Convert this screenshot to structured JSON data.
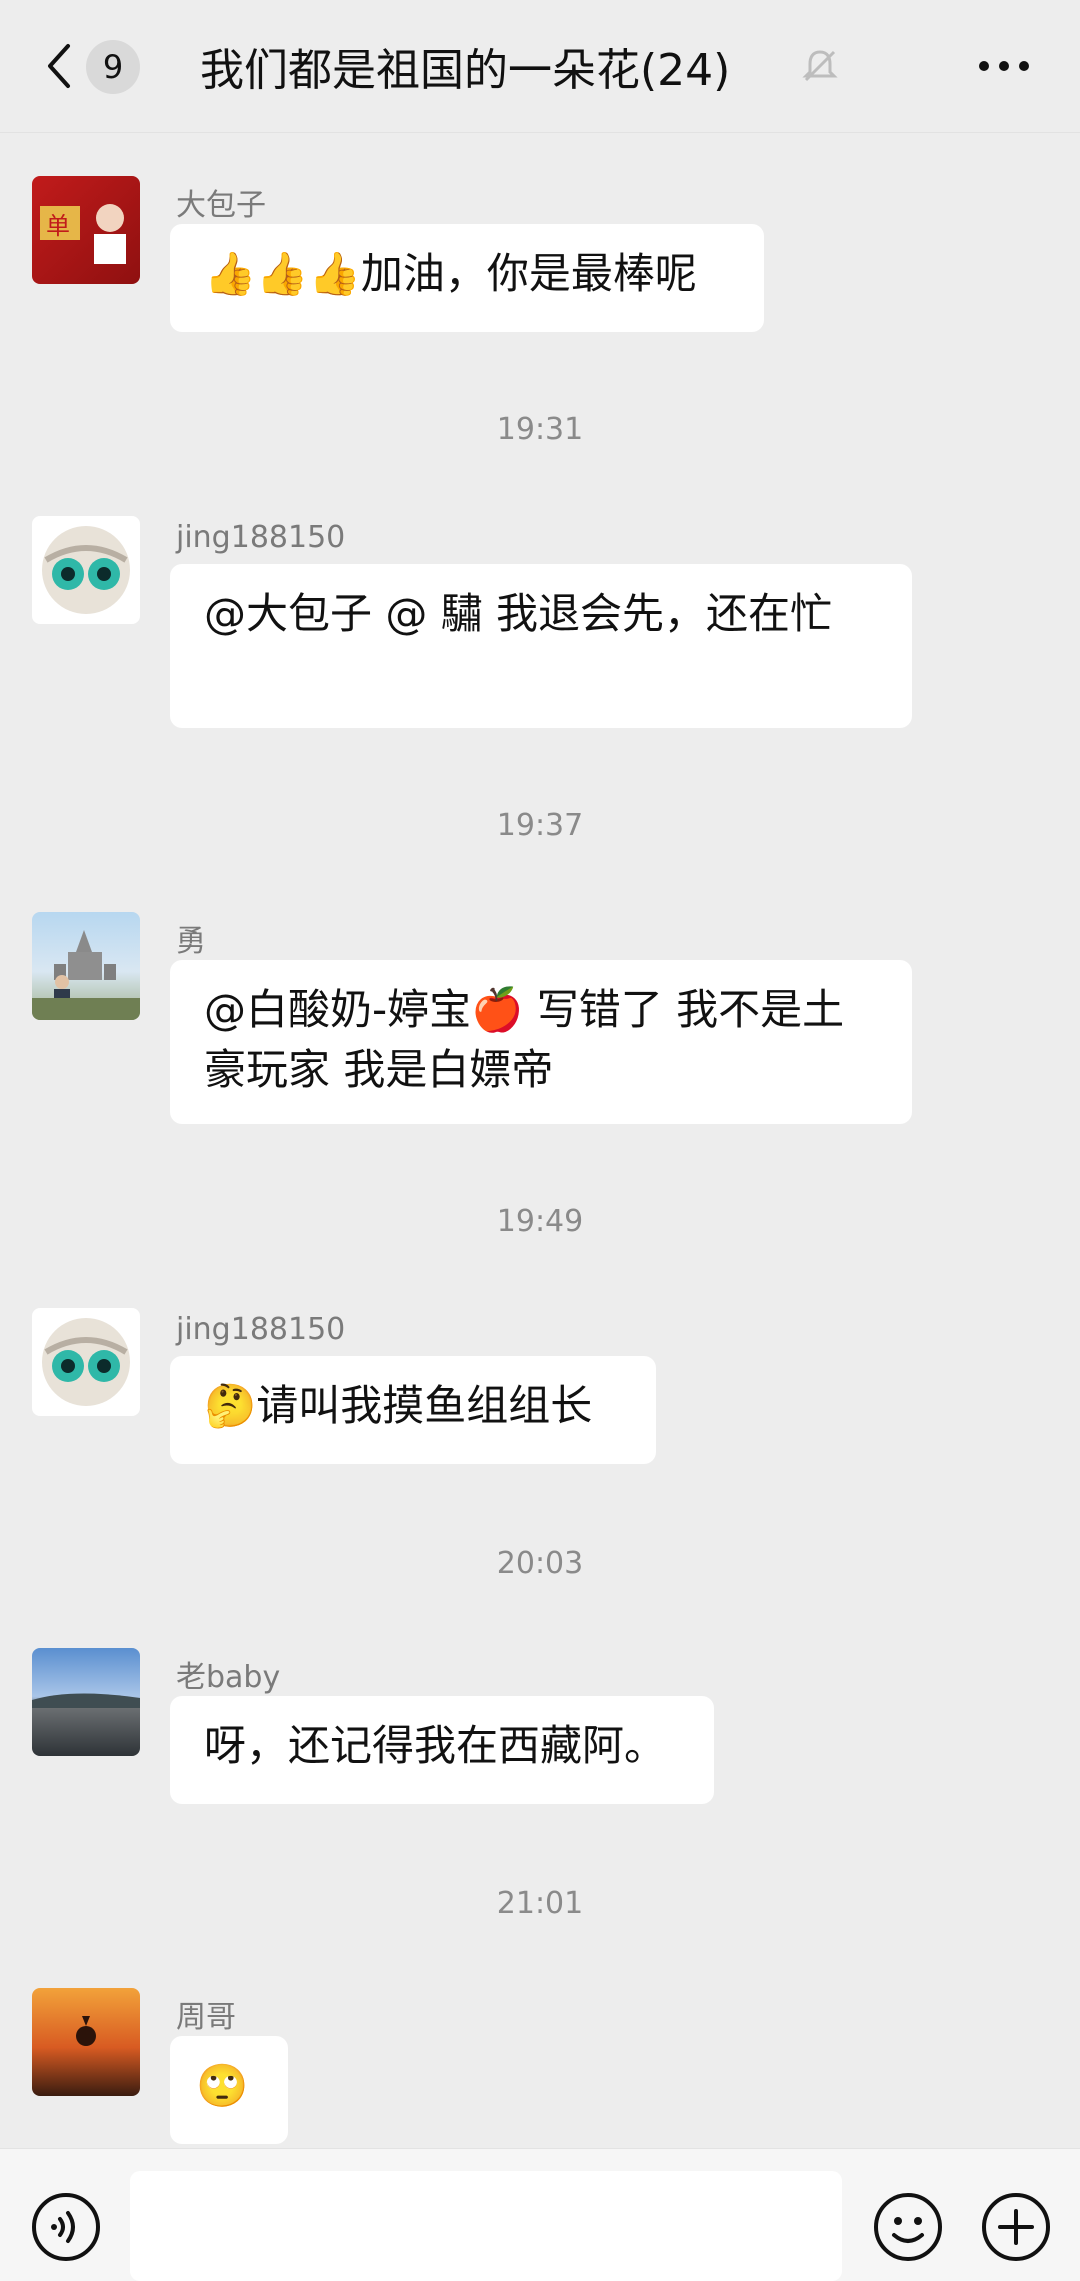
{
  "header": {
    "unread_count": "9",
    "title": "我们都是祖国的一朵花(24)"
  },
  "messages": [
    {
      "sender": "大包子",
      "text": "👍👍👍加油，你是最棒呢"
    },
    {
      "time": "19:31"
    },
    {
      "sender": "jing188150",
      "text": "@大包子 @    驌             我退会先，还在忙"
    },
    {
      "time": "19:37"
    },
    {
      "sender": "勇",
      "text": "@白酸奶-婷宝🍎  写错了  我不是土豪玩家  我是白嫖帝"
    },
    {
      "time": "19:49"
    },
    {
      "sender": "jing188150",
      "text": "🤔请叫我摸鱼组组长"
    },
    {
      "time": "20:03"
    },
    {
      "sender": "老baby",
      "text": "呀，还记得我在西藏阿。"
    },
    {
      "time": "21:01"
    },
    {
      "sender": "周哥",
      "text": "🙄"
    }
  ],
  "input": {
    "value": ""
  },
  "icons": {
    "back": "chevron-left-icon",
    "mute": "bell-off-icon",
    "more": "more-dots-icon",
    "voice": "voice-icon",
    "emoji": "emoji-icon",
    "add": "plus-icon"
  }
}
